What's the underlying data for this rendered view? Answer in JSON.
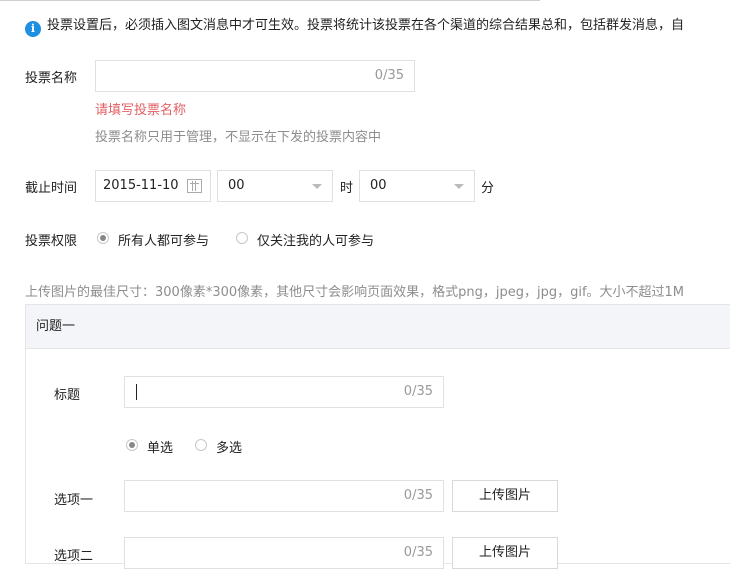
{
  "notice": {
    "text": "投票设置后，必须插入图文消息中才可生效。投票将统计该投票在各个渠道的综合结果总和，包括群发消息，自"
  },
  "vote_name": {
    "label": "投票名称",
    "counter": "0/35",
    "error": "请填写投票名称",
    "hint": "投票名称只用于管理，不显示在下发的投票内容中"
  },
  "deadline": {
    "label": "截止时间",
    "date": "2015-11-10",
    "hour": "00",
    "hour_unit": "时",
    "minute": "00",
    "minute_unit": "分"
  },
  "permission": {
    "label": "投票权限",
    "options": [
      "所有人都可参与",
      "仅关注我的人可参与"
    ],
    "selected": 0
  },
  "upload_hint": "上传图片的最佳尺寸：300像素*300像素，其他尺寸会影响页面效果，格式png，jpeg，jpg，gif。大小不超过1M",
  "question": {
    "header": "问题一",
    "title_label": "标题",
    "title_counter": "0/35",
    "type_options": [
      "单选",
      "多选"
    ],
    "type_selected": 0,
    "options": [
      {
        "label": "选项一",
        "counter": "0/35",
        "upload": "上传图片"
      },
      {
        "label": "选项二",
        "counter": "0/35",
        "upload": "上传图片"
      }
    ]
  },
  "icons": {
    "info": "info-icon",
    "calendar": "calendar-icon",
    "dropdown": "chevron-down-icon"
  },
  "colors": {
    "info_blue": "#1e8fe1",
    "error_red": "#e15f63",
    "panel_header_bg": "#f4f5f9"
  }
}
